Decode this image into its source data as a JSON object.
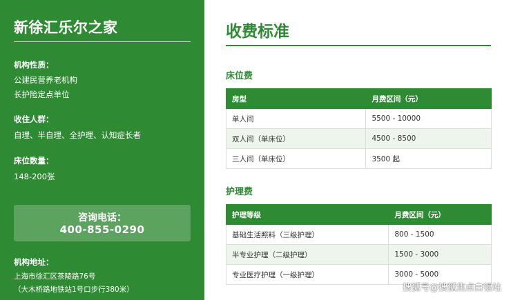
{
  "colors": {
    "brand_green": "#2f8a34",
    "row_alt": "#eef5ec"
  },
  "sidebar": {
    "org_name": "新徐汇乐尔之家",
    "nature_label": "机构性质：",
    "nature_lines": [
      "公建民营养老机构",
      "长护险定点单位"
    ],
    "residents_label": "收住人群：",
    "residents_text": "自理、半自理、全护理、认知症长者",
    "beds_label": "床位数量：",
    "beds_text": "148-200张",
    "phone_label": "咨询电话：",
    "phone_number": "400-855-0290",
    "address_label": "机构地址：",
    "address_lines": [
      "上海市徐汇区茶陵路76号",
      "（大木桥路地铁站1号口步行380米）"
    ]
  },
  "main": {
    "title": "收费标准",
    "bed_section": {
      "title": "床位费",
      "headers": [
        "房型",
        "月费区间（元）"
      ],
      "rows": [
        [
          "单人间",
          "5500 - 10000"
        ],
        [
          "双人间（单床位）",
          "4500 - 8500"
        ],
        [
          "三人间（单床位）",
          "3500 起"
        ]
      ]
    },
    "care_section": {
      "title": "护理费",
      "headers": [
        "护理等级",
        "月费区间（元）"
      ],
      "rows": [
        [
          "基础生活照料（三级护理）",
          "800 - 1500"
        ],
        [
          "半专业护理（二级护理）",
          "1500 - 3000"
        ],
        [
          "专业医疗护理（一级护理）",
          "3000 - 5000"
        ]
      ]
    }
  },
  "watermark": "搜狐号@搜狐焦点白银站"
}
